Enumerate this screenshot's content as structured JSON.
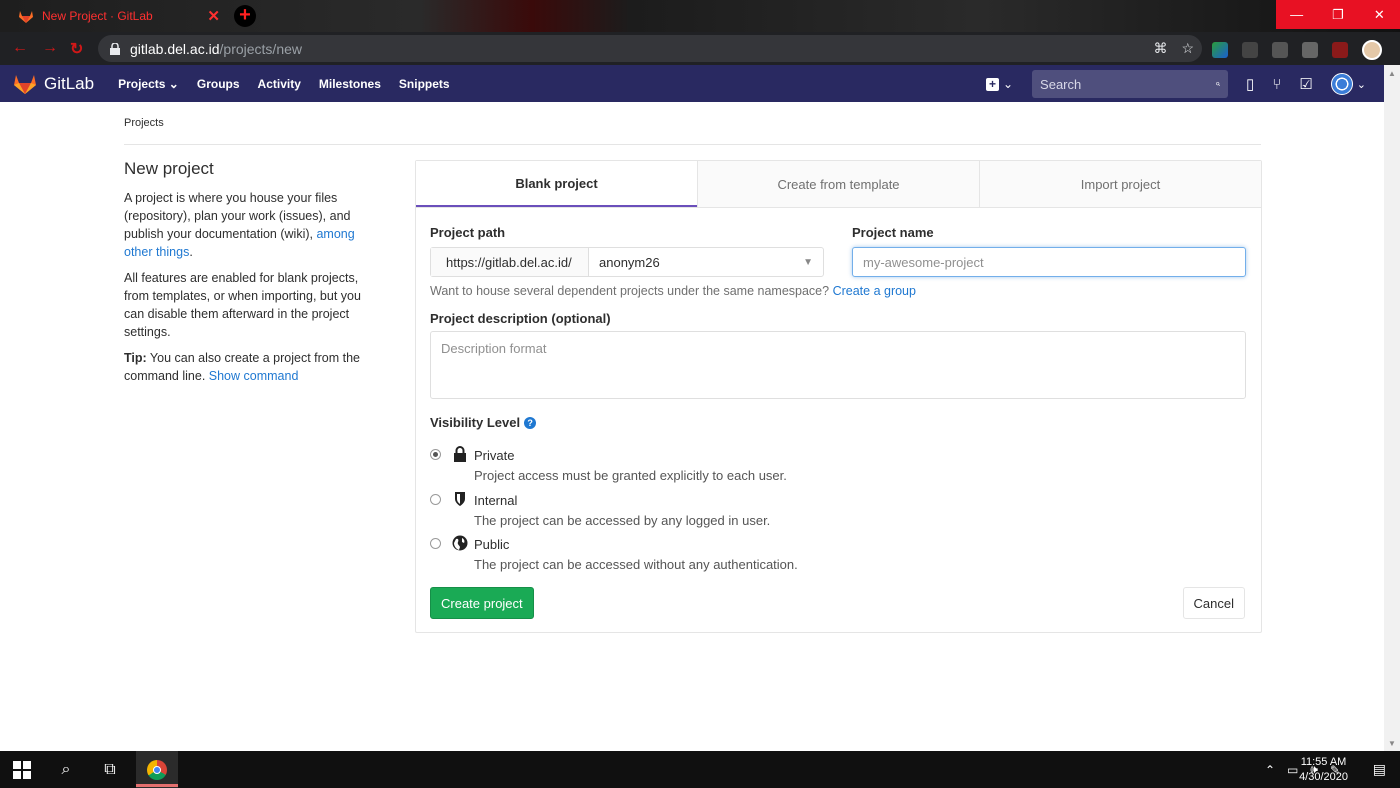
{
  "browser": {
    "tab_title": "New Project · GitLab",
    "url_host": "gitlab.del.ac.id",
    "url_path": "/projects/new"
  },
  "nav": {
    "brand": "GitLab",
    "links": [
      "Projects",
      "Groups",
      "Activity",
      "Milestones",
      "Snippets"
    ],
    "search_placeholder": "Search"
  },
  "breadcrumb": "Projects",
  "sidebar": {
    "title": "New project",
    "p1_text": "A project is where you house your files (repository), plan your work (issues), and publish your documentation (wiki), ",
    "p1_link": "among other things",
    "p1_end": ".",
    "p2": "All features are enabled for blank projects, from templates, or when importing, but you can disable them afterward in the project settings.",
    "tip_label": "Tip:",
    "tip_text": " You can also create a project from the command line. ",
    "tip_link": "Show command"
  },
  "tabs": [
    "Blank project",
    "Create from template",
    "Import project"
  ],
  "form": {
    "path_label": "Project path",
    "path_prefix": "https://gitlab.del.ac.id/",
    "namespace": "anonym26",
    "name_label": "Project name",
    "name_placeholder": "my-awesome-project",
    "hint_text": "Want to house several dependent projects under the same namespace? ",
    "hint_link": "Create a group",
    "desc_label": "Project description (optional)",
    "desc_placeholder": "Description format",
    "visibility_label": "Visibility Level",
    "visibility": [
      {
        "title": "Private",
        "desc": "Project access must be granted explicitly to each user.",
        "checked": true
      },
      {
        "title": "Internal",
        "desc": "The project can be accessed by any logged in user.",
        "checked": false
      },
      {
        "title": "Public",
        "desc": "The project can be accessed without any authentication.",
        "checked": false
      }
    ],
    "create_label": "Create project",
    "cancel_label": "Cancel"
  },
  "taskbar": {
    "time": "11:55 AM",
    "date": "4/30/2020"
  },
  "colors": {
    "nav_bg": "#292961",
    "primary_green": "#1aaa55",
    "link_blue": "#1f78d1",
    "active_tab_border": "#6b4fbb"
  }
}
